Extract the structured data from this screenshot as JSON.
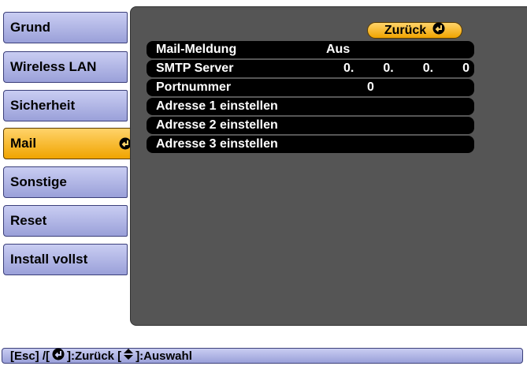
{
  "sidebar": {
    "items": [
      {
        "label": "Grund"
      },
      {
        "label": "Wireless LAN"
      },
      {
        "label": "Sicherheit"
      },
      {
        "label": "Mail"
      },
      {
        "label": "Sonstige"
      },
      {
        "label": "Reset"
      },
      {
        "label": "Install vollst"
      }
    ],
    "active_index": 3
  },
  "panel": {
    "back_label": "Zurück",
    "rows": [
      {
        "label": "Mail-Meldung",
        "value": "Aus"
      },
      {
        "label": "SMTP Server",
        "ip": [
          "0.",
          "0.",
          "0.",
          "0"
        ]
      },
      {
        "label": "Portnummer",
        "value": "0"
      },
      {
        "label": "Adresse 1 einstellen"
      },
      {
        "label": "Adresse 2 einstellen"
      },
      {
        "label": "Adresse 3 einstellen"
      }
    ]
  },
  "footer": {
    "esc": "[Esc] /[",
    "back": "]:Zurück  [",
    "select": "]:Auswahl"
  },
  "icons": {
    "enter": "enter-icon",
    "updown": "up-down-arrow-icon"
  },
  "colors": {
    "active": "#f0a400",
    "menu": "#9aa0d9",
    "panel": "#555555"
  }
}
